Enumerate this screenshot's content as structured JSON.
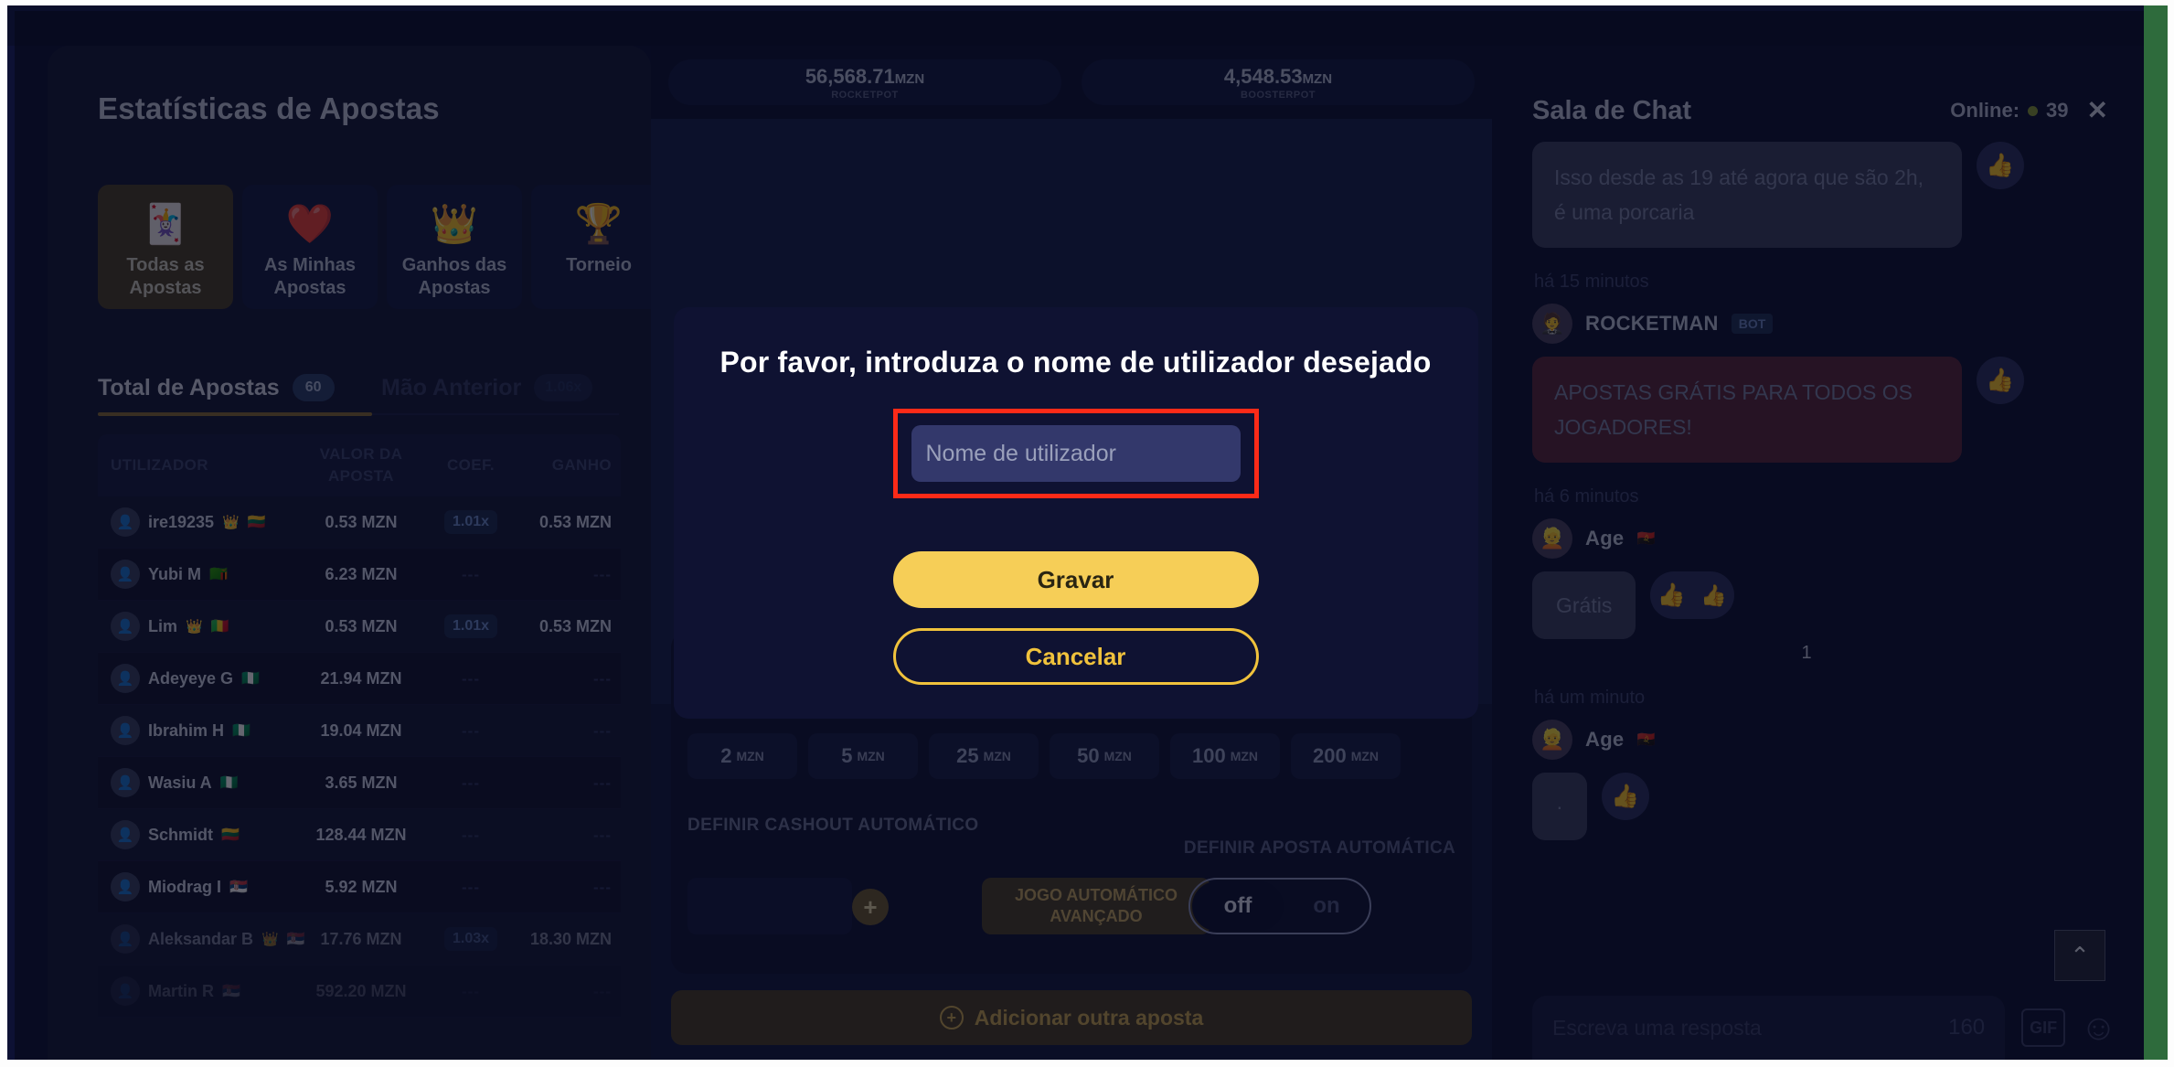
{
  "stats_panel": {
    "title": "Estatísticas de Apostas",
    "tabs": [
      {
        "icon": "cards-icon",
        "glyph": "🃏",
        "label": "Todas as Apostas",
        "active": true
      },
      {
        "icon": "heart-icon",
        "glyph": "❤️",
        "label": "As Minhas Apostas",
        "active": false
      },
      {
        "icon": "crown-icon",
        "glyph": "👑",
        "label": "Ganhos das Apostas",
        "active": false
      },
      {
        "icon": "trophy-icon",
        "glyph": "🏆",
        "label": "Torneio",
        "active": false
      }
    ],
    "subtabs": [
      {
        "label": "Total de Apostas",
        "badge": "60",
        "active": true
      },
      {
        "label": "Mão Anterior",
        "badge": "1.06x",
        "active": false
      }
    ],
    "table": {
      "headers": [
        "UTILIZADOR",
        "VALOR DA APOSTA",
        "COEF.",
        "GANHO"
      ],
      "rows": [
        {
          "name": "ire19235",
          "crown": "👑",
          "flag": "🇱🇹",
          "stake": "0.53 MZN",
          "coef": "1.01x",
          "win": "0.53 MZN"
        },
        {
          "name": "Yubi M",
          "crown": "",
          "flag": "🇿🇲",
          "stake": "6.23 MZN",
          "coef": "---",
          "win": "---"
        },
        {
          "name": "Lim",
          "crown": "👑",
          "flag": "🇲🇱",
          "stake": "0.53 MZN",
          "coef": "1.01x",
          "win": "0.53 MZN"
        },
        {
          "name": "Adeyeye G",
          "crown": "",
          "flag": "🇳🇬",
          "stake": "21.94 MZN",
          "coef": "---",
          "win": "---"
        },
        {
          "name": "Ibrahim H",
          "crown": "",
          "flag": "🇳🇬",
          "stake": "19.04 MZN",
          "coef": "---",
          "win": "---"
        },
        {
          "name": "Wasiu A",
          "crown": "",
          "flag": "🇳🇬",
          "stake": "3.65 MZN",
          "coef": "---",
          "win": "---"
        },
        {
          "name": "Schmidt",
          "crown": "",
          "flag": "🇱🇹",
          "stake": "128.44 MZN",
          "coef": "---",
          "win": "---"
        },
        {
          "name": "Miodrag I",
          "crown": "",
          "flag": "🇷🇸",
          "stake": "5.92 MZN",
          "coef": "---",
          "win": "---"
        },
        {
          "name": "Aleksandar B",
          "crown": "👑",
          "flag": "🇷🇸",
          "stake": "17.76 MZN",
          "coef": "1.03x",
          "win": "18.30 MZN"
        },
        {
          "name": "Martin R",
          "crown": "",
          "flag": "🇷🇸",
          "stake": "592.20 MZN",
          "coef": "---",
          "win": "---"
        }
      ]
    }
  },
  "game_panel": {
    "pots": [
      {
        "amount": "56,568.71",
        "currency": "MZN",
        "name": "ROCKETPOT"
      },
      {
        "amount": "4,548.53",
        "currency": "MZN",
        "name": "BOOSTERPOT"
      }
    ],
    "quick_chips": [
      {
        "value": "2",
        "unit": "MZN"
      },
      {
        "value": "5",
        "unit": "MZN"
      },
      {
        "value": "25",
        "unit": "MZN"
      },
      {
        "value": "50",
        "unit": "MZN"
      },
      {
        "value": "100",
        "unit": "MZN"
      },
      {
        "value": "200",
        "unit": "MZN"
      }
    ],
    "cashout_label": "DEFINIR CASHOUT AUTOMÁTICO",
    "autobet_label": "DEFINIR APOSTA AUTOMÁTICA",
    "plus_symbol": "+",
    "advanced_auto_label": "JOGO AUTOMÁTICO AVANÇADO",
    "toggle": {
      "off": "off",
      "on": "on",
      "state": "off"
    },
    "add_bet_label": "Adicionar outra aposta",
    "add_bet_icon": "+"
  },
  "chat": {
    "title": "Sala de Chat",
    "online_label": "Online:",
    "online_count": "39",
    "close_icon": "✕",
    "messages": [
      {
        "text": "Isso desde as 19 até agora que são 2h, é uma porcaria",
        "style": "grey",
        "timestamp": "há 15 minutos",
        "author": "ROCKETMAN",
        "author_tag": "BOT",
        "author_flag": "",
        "likes": ""
      },
      {
        "text": "APOSTAS GRÁTIS PARA TODOS OS JOGADORES!",
        "style": "red",
        "timestamp": "há 6 minutos",
        "author": "Age",
        "author_tag": "",
        "author_flag": "🇦🇴",
        "likes": ""
      },
      {
        "text": "Grátis",
        "style": "grey-small",
        "timestamp": "há um minuto",
        "author": "Age",
        "author_tag": "",
        "author_flag": "🇦🇴",
        "likes": "1"
      },
      {
        "text": "·",
        "style": "grey-small",
        "timestamp": "",
        "author": "",
        "author_tag": "",
        "author_flag": "",
        "likes": ""
      }
    ],
    "input_placeholder": "Escreva uma resposta",
    "char_count": "160",
    "gif_label": "GIF",
    "emoji_icon": "☺",
    "scroll_top_icon": "⌃",
    "thumb_icon": "👍"
  },
  "modal": {
    "title": "Por favor, introduza o nome de utilizador desejado",
    "input_placeholder": "Nome de utilizador",
    "input_value": "",
    "save_label": "Gravar",
    "cancel_label": "Cancelar",
    "highlight_color": "#fc2a18"
  }
}
